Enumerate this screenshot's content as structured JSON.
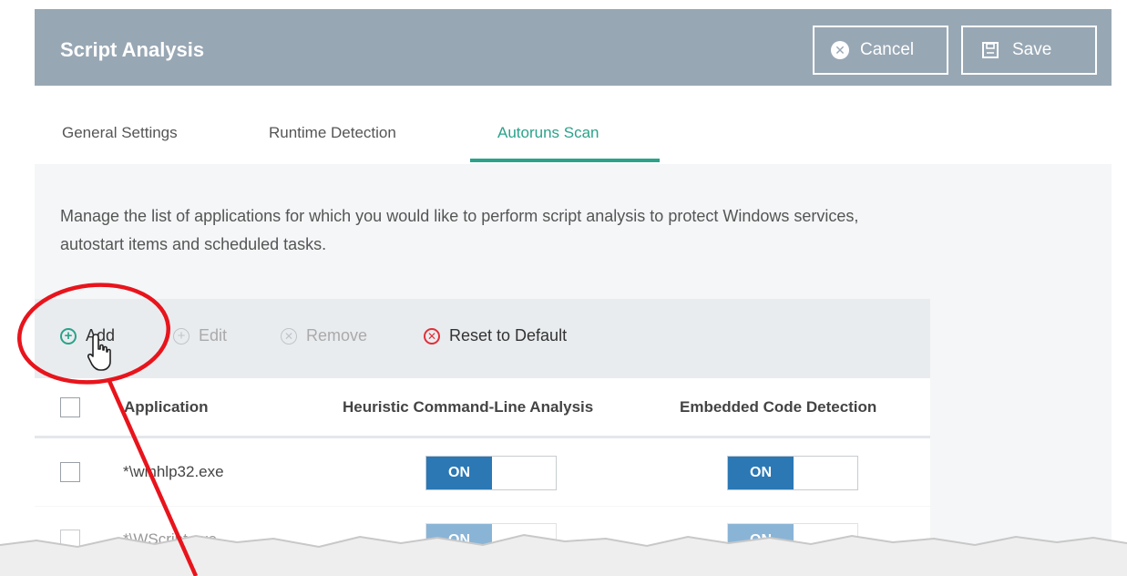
{
  "header": {
    "title": "Script Analysis",
    "cancel_label": "Cancel",
    "save_label": "Save",
    "color": "#98a7b4"
  },
  "tabs": [
    {
      "label": "General Settings",
      "active": false
    },
    {
      "label": "Runtime Detection",
      "active": false
    },
    {
      "label": "Autoruns Scan",
      "active": true
    }
  ],
  "accent_color": "#2aa38a",
  "description": "Manage the list of applications for which you would like to perform script analysis to protect Windows services, autostart items and scheduled tasks.",
  "toolbar": {
    "add_label": "Add",
    "edit_label": "Edit",
    "remove_label": "Remove",
    "reset_label": "Reset to Default"
  },
  "table": {
    "columns": [
      "Application",
      "Heuristic Command-Line Analysis",
      "Embedded Code Detection"
    ],
    "rows": [
      {
        "application": "*\\winhlp32.exe",
        "heuristic": "ON",
        "embedded": "ON"
      },
      {
        "application": "*\\WScript.exe",
        "heuristic": "ON",
        "embedded": "ON"
      }
    ]
  },
  "toggle_color": "#2b78b5",
  "annotation_color": "#e8141c"
}
